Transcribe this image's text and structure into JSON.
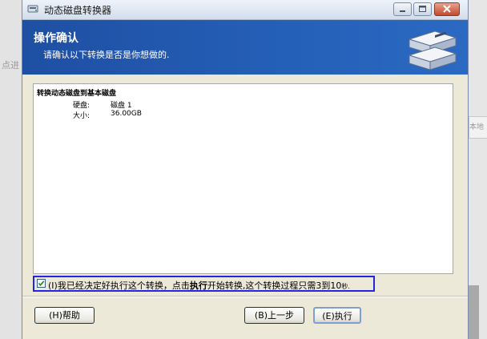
{
  "background": {
    "left_partial_text": "点进",
    "right_partial_text": "本地"
  },
  "window": {
    "title": "动态磁盘转换器",
    "controls": [
      "minimize-icon",
      "maximize-icon",
      "close-icon"
    ]
  },
  "header": {
    "title": "操作确认",
    "subtitle": "请确认以下转换是否是你想做的."
  },
  "details": {
    "section_title": "转换动态磁盘到基本磁盘",
    "rows": [
      {
        "label": "硬盘:",
        "value": "磁盘 1"
      },
      {
        "label": "大小:",
        "value": "36.00GB"
      }
    ]
  },
  "confirm": {
    "checked": true,
    "text_prefix": "(I)我已经决定好执行这个转换，点击",
    "text_bold": "执行",
    "text_middle": "开始转换,这个转换过程只需3到10",
    "text_tail": "秒."
  },
  "buttons": {
    "help": "(H)帮助",
    "prev": "(B)上一步",
    "exec": "(E)执行"
  },
  "colors": {
    "header_blue": "#2560b8",
    "confirm_outline": "#2424e6"
  }
}
